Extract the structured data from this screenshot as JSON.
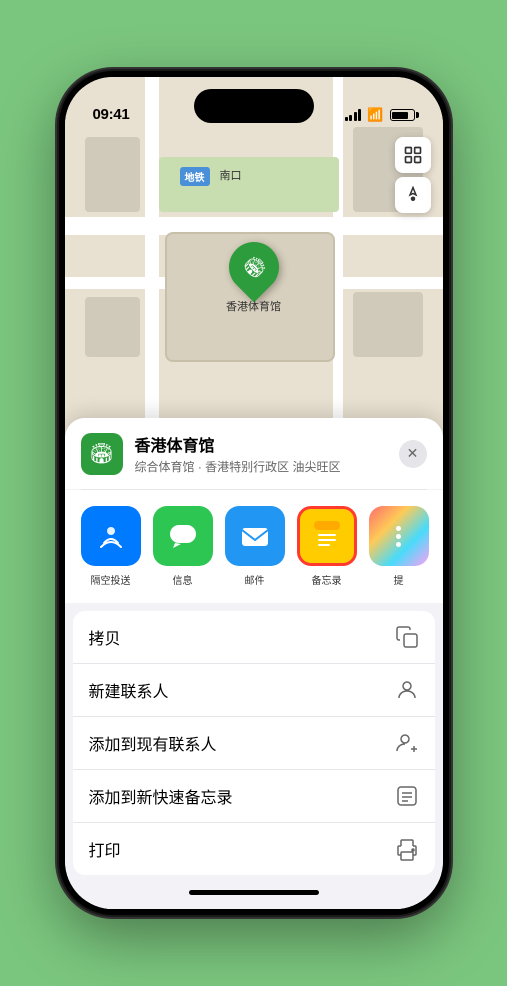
{
  "status_bar": {
    "time": "09:41",
    "signal_label": "signal",
    "wifi_label": "wifi",
    "battery_label": "battery"
  },
  "map": {
    "metro_prefix": "地铁",
    "station_label": "南口",
    "pin_label": "香港体育馆",
    "layers_button_label": "地图图层",
    "location_button_label": "当前位置"
  },
  "venue_card": {
    "name": "香港体育馆",
    "subtitle": "综合体育馆 · 香港特别行政区 油尖旺区",
    "close_label": "✕"
  },
  "share_row": {
    "items": [
      {
        "id": "airdrop",
        "label": "隔空投送",
        "icon": "📡"
      },
      {
        "id": "messages",
        "label": "信息",
        "icon": "💬"
      },
      {
        "id": "mail",
        "label": "邮件",
        "icon": "✉️"
      },
      {
        "id": "notes",
        "label": "备忘录",
        "icon": "📝",
        "selected": true
      },
      {
        "id": "more",
        "label": "提",
        "icon": "···"
      }
    ]
  },
  "action_rows": [
    {
      "id": "copy",
      "label": "拷贝",
      "icon": "copy"
    },
    {
      "id": "new-contact",
      "label": "新建联系人",
      "icon": "person"
    },
    {
      "id": "add-existing",
      "label": "添加到现有联系人",
      "icon": "person-plus"
    },
    {
      "id": "add-notes",
      "label": "添加到新快速备忘录",
      "icon": "note"
    },
    {
      "id": "print",
      "label": "打印",
      "icon": "print"
    }
  ]
}
